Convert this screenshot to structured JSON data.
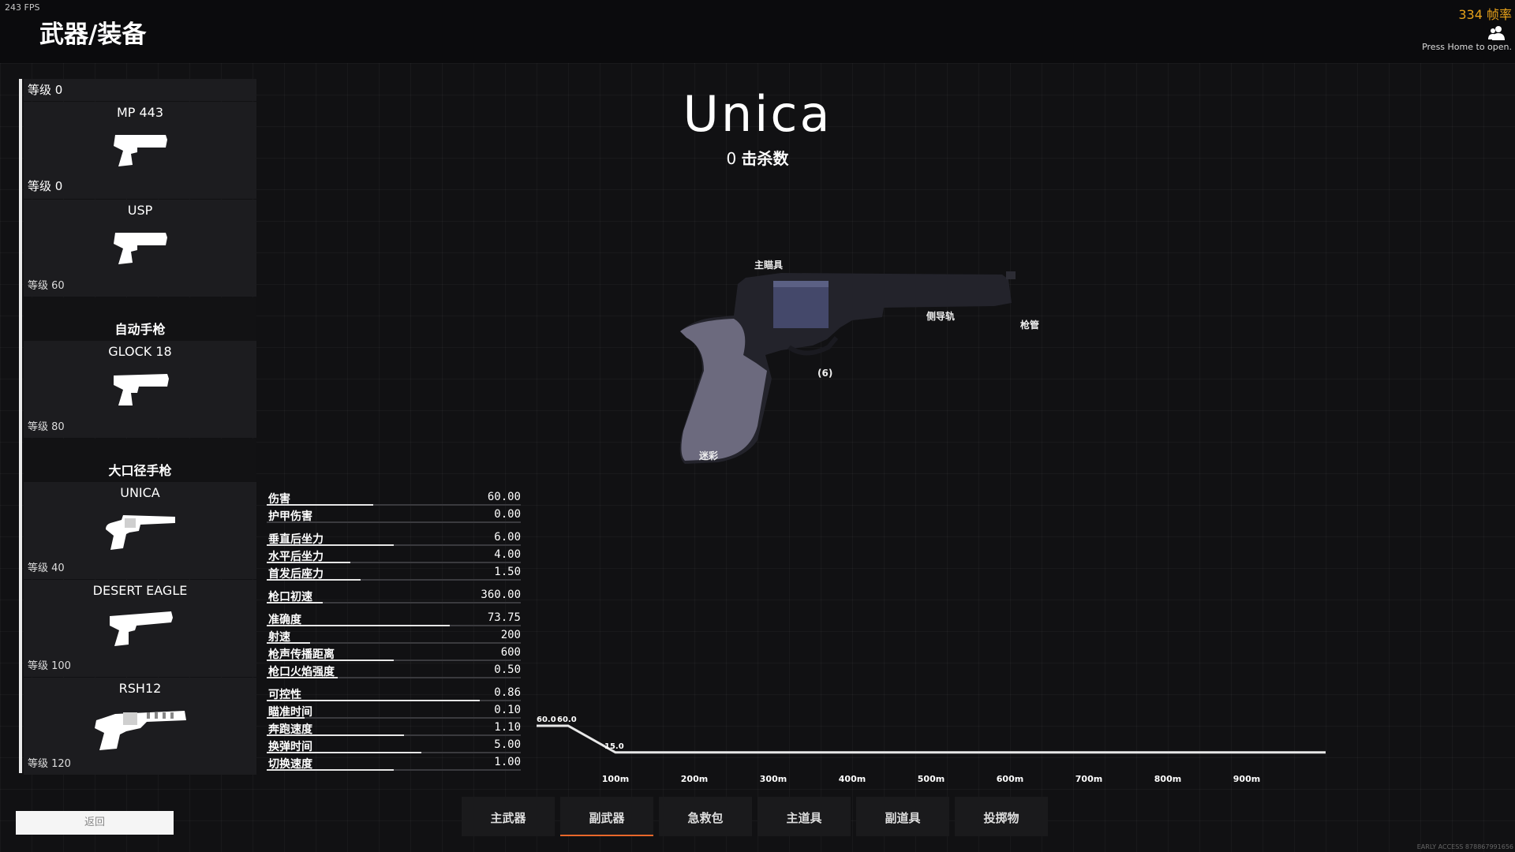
{
  "hud": {
    "fps": "243 FPS",
    "title": "武器/装备",
    "rate": "334 帧率",
    "press_home": "Press Home to open.",
    "early_access": "EARLY ACCESS 878867991656"
  },
  "weapon_list": {
    "top_level": "等级 0",
    "items": [
      {
        "name": "MP 443",
        "level": "等级 0"
      },
      {
        "name": "USP",
        "level": "等级 60"
      }
    ],
    "categories": [
      {
        "title": "自动手枪",
        "items": [
          {
            "name": "GLOCK 18",
            "level": "等级 80"
          }
        ]
      },
      {
        "title": "大口径手枪",
        "items": [
          {
            "name": "UNICA",
            "level": "等级 40"
          },
          {
            "name": "DESERT EAGLE",
            "level": "等级 100"
          },
          {
            "name": "RSH12",
            "level": "等级 120"
          }
        ]
      }
    ]
  },
  "back_label": "返回",
  "weapon": {
    "name": "Unica",
    "kills_count": "0",
    "kills_label": "击杀数",
    "attachments": {
      "sight": "主瞄具",
      "side_rail": "侧导轨",
      "barrel": "枪管",
      "ammo": "(6)",
      "camo": "迷彩"
    }
  },
  "stats": [
    {
      "label": "伤害",
      "value": "60.00",
      "fill": 0.42
    },
    {
      "label": "护甲伤害",
      "value": "0.00",
      "fill": 0.0
    },
    {
      "label": "垂直后坐力",
      "value": "6.00",
      "fill": 0.5
    },
    {
      "label": "水平后坐力",
      "value": "4.00",
      "fill": 0.33
    },
    {
      "label": "首发后座力",
      "value": "1.50",
      "fill": 0.37
    },
    {
      "label": "枪口初速",
      "value": "360.00",
      "fill": 0.22
    },
    {
      "label": "准确度",
      "value": "73.75",
      "fill": 0.72
    },
    {
      "label": "射速",
      "value": "200",
      "fill": 0.17
    },
    {
      "label": "枪声传播距离",
      "value": "600",
      "fill": 0.5
    },
    {
      "label": "枪口火焰强度",
      "value": "0.50",
      "fill": 0.28
    },
    {
      "label": "可控性",
      "value": "0.86",
      "fill": 0.84
    },
    {
      "label": "瞄准时间",
      "value": "0.10",
      "fill": 0.15
    },
    {
      "label": "奔跑速度",
      "value": "1.10",
      "fill": 0.54
    },
    {
      "label": "换弹时间",
      "value": "5.00",
      "fill": 0.61
    },
    {
      "label": "切换速度",
      "value": "1.00",
      "fill": 0.5
    }
  ],
  "chart_data": {
    "type": "line",
    "x": [
      0,
      40,
      100,
      1000
    ],
    "values": [
      60,
      60,
      15,
      15
    ],
    "point_labels": [
      "60.0",
      "60.0",
      "15.0"
    ],
    "x_ticks": [
      "100m",
      "200m",
      "300m",
      "400m",
      "500m",
      "600m",
      "700m",
      "800m",
      "900m"
    ],
    "tick_values": [
      100,
      200,
      300,
      400,
      500,
      600,
      700,
      800,
      900
    ],
    "xlim": [
      0,
      1000
    ],
    "ylim": [
      0,
      60
    ],
    "grid": false
  },
  "tabs": [
    {
      "label": "主武器",
      "active": false
    },
    {
      "label": "副武器",
      "active": true
    },
    {
      "label": "急救包",
      "active": false
    },
    {
      "label": "主道具",
      "active": false
    },
    {
      "label": "副道具",
      "active": false
    },
    {
      "label": "投掷物",
      "active": false
    }
  ]
}
